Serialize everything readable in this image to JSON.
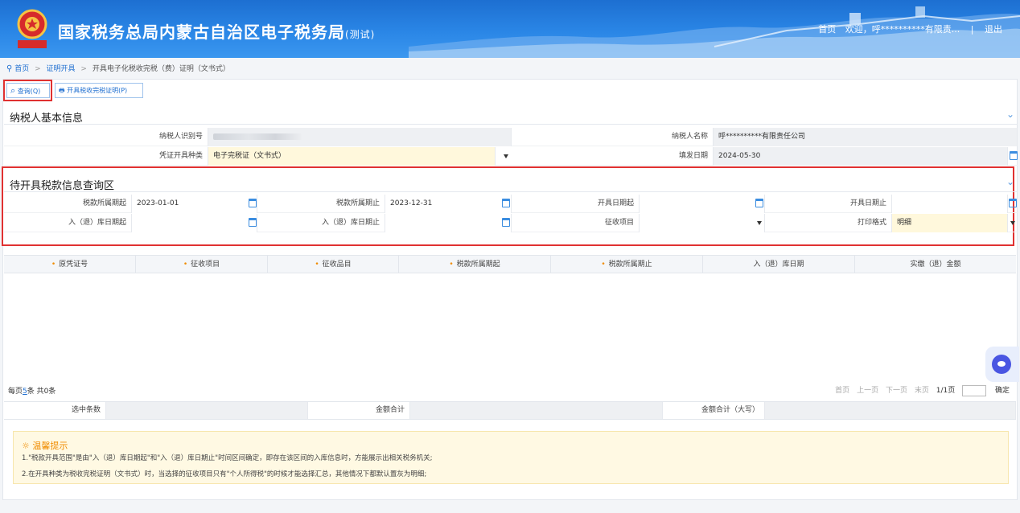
{
  "header": {
    "title": "国家税务总局内蒙古自治区电子税务局",
    "title_suffix": "(测试)",
    "emblem_caption": "中国税务",
    "links": {
      "home": "首页",
      "welcome": "欢迎，呼**********有限责...",
      "separator": "|",
      "logout": "退出"
    }
  },
  "breadcrumb": {
    "home": "首页",
    "sep": ">",
    "level2": "证明开具",
    "level3": "开具电子化税收完税（费）证明（文书式）"
  },
  "toolbar": {
    "query": "查询(Q)",
    "print": "开具税收完税证明(P)"
  },
  "taxpayer_section": {
    "title": "纳税人基本信息",
    "taxpayer_id_label": "纳税人识别号",
    "taxpayer_id_value": "",
    "taxpayer_name_label": "纳税人名称",
    "taxpayer_name_value": "呼**********有限责任公司",
    "cert_type_label": "凭证开具种类",
    "cert_type_value": "电子完税证（文书式）",
    "fill_date_label": "填发日期",
    "fill_date_value": "2024-05-30"
  },
  "query_section": {
    "title": "待开具税款信息查询区",
    "period_start_label": "税款所属期起",
    "period_start_value": "2023-01-01",
    "period_end_label": "税款所属期止",
    "period_end_value": "2023-12-31",
    "issue_start_label": "开具日期起",
    "issue_start_value": "",
    "issue_end_label": "开具日期止",
    "issue_end_value": "",
    "storage_start_label": "入（退）库日期起",
    "storage_start_value": "",
    "storage_end_label": "入（退）库日期止",
    "storage_end_value": "",
    "levy_item_label": "征收项目",
    "levy_item_value": "",
    "print_format_label": "打印格式",
    "print_format_value": "明细"
  },
  "table": {
    "columns": [
      "原凭证号",
      "征收项目",
      "征收品目",
      "税款所属期起",
      "税款所属期止",
      "入（退）库日期",
      "实缴（退）金额"
    ]
  },
  "pager": {
    "per_page_prefix": "每页",
    "per_page": "5",
    "per_page_suffix": "条 共0条",
    "first": "首页",
    "prev": "上一页",
    "next": "下一页",
    "last": "末页",
    "page": "1/1页",
    "confirm": "确定"
  },
  "summary": {
    "selected_label": "选中条数",
    "amount_label": "金额合计",
    "amount_upper_label": "金额合计（大写）"
  },
  "tips": {
    "title": "温馨提示",
    "line1": "1.\"税款开具范围\"是由\"入（退）库日期起\"和\"入（退）库日期止\"时间区间确定，即存在该区间的入库信息时，方能展示出相关税务机关;",
    "line2": "2.在开具种类为税收完税证明（文书式）时，当选择的征收项目只有\"个人所得税\"的时候才能选择汇总，其他情况下都默认置灰为明细;"
  }
}
